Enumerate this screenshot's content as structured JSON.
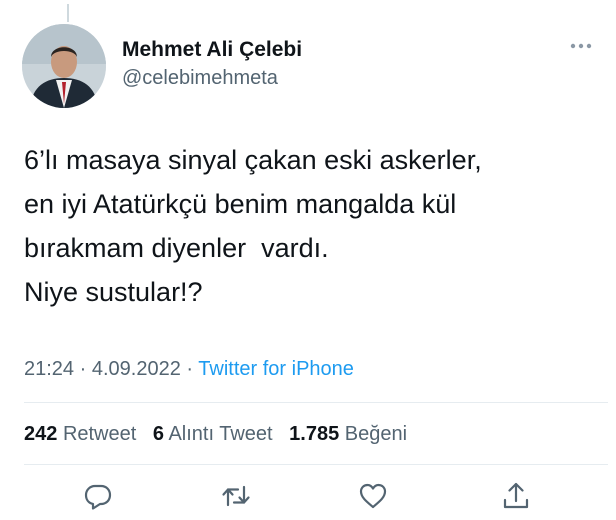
{
  "author": {
    "display_name": "Mehmet Ali Çelebi",
    "handle": "@celebimehmeta",
    "avatar_icon": "profile-photo"
  },
  "tweet": {
    "lines": [
      "6’lı masaya sinyal çakan eski askerler,",
      "en iyi Atatürkçü benim mangalda kül",
      "bırakmam diyenler  vardı.",
      "Niye sustular!?"
    ]
  },
  "meta": {
    "time": "21:24",
    "date": "4.09.2022",
    "separator": "·",
    "source": "Twitter for iPhone"
  },
  "stats": {
    "retweets": {
      "count": "242",
      "label": "Retweet"
    },
    "quotes": {
      "count": "6",
      "label": "Alıntı Tweet"
    },
    "likes": {
      "count": "1.785",
      "label": "Beğeni"
    }
  },
  "actions": [
    {
      "icon": "reply-icon"
    },
    {
      "icon": "retweet-icon"
    },
    {
      "icon": "like-icon"
    },
    {
      "icon": "share-icon"
    }
  ],
  "colors": {
    "text": "#0f1419",
    "secondary": "#536471",
    "link": "#1d9bf0",
    "divider": "#e6ecf0"
  }
}
